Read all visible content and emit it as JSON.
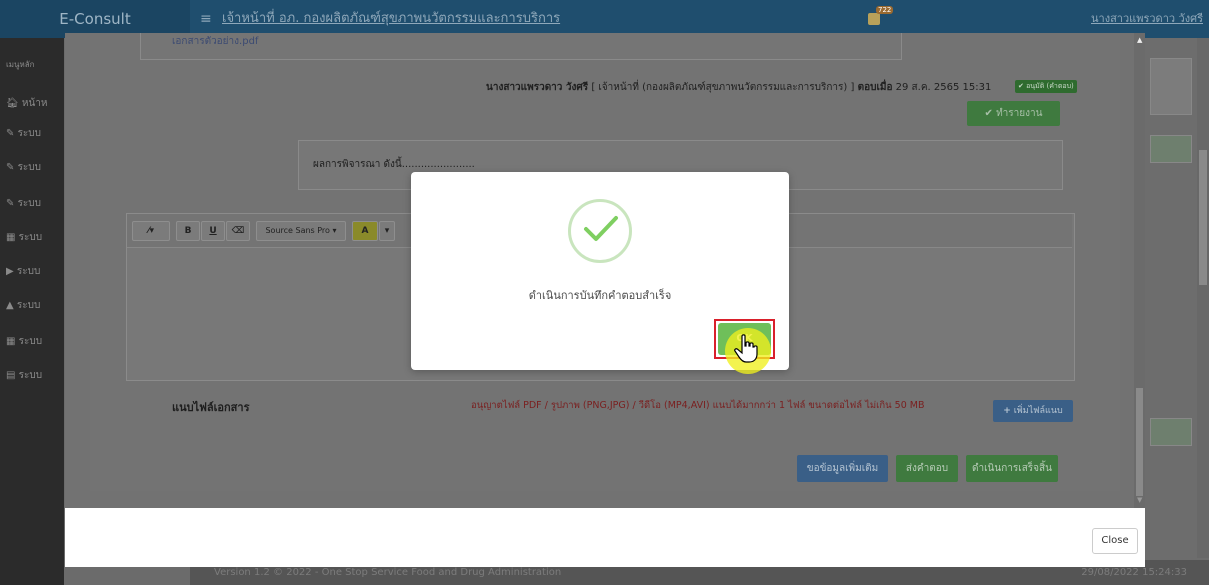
{
  "header": {
    "brand": "E-Consult",
    "title": "เจ้าหน้าที่ อภ. กองผลิตภัณฑ์สุขภาพนวัตกรรมและการบริการ",
    "notif_count": "722",
    "user": "นางสาวแพรวดาว วังศรี"
  },
  "sidebar": {
    "heading": "เมนูหลัก",
    "items": [
      "หน้าห",
      "ระบบ",
      "ระบบ",
      "ระบบ",
      "ระบบ",
      "ระบบ",
      "ระบบ",
      "ระบบ",
      "ระบบ"
    ]
  },
  "modal": {
    "attachment_file": "เอกสารตัวอย่าง.pdf",
    "reply": {
      "author": "นางสาวแพรวดาว วังศรี",
      "role": "[ เจ้าหน้าที่ (กองผลิตภัณฑ์สุขภาพนวัตกรรมและการบริการ) ]",
      "answered_label": "ตอบเมื่อ",
      "date": "29 ส.ค. 2565 15:31",
      "status_badge": "อนุมัติ (คำตอบ)",
      "report_button": "ทำรายงาน"
    },
    "comment_text": "ผลการพิจารณา ดังนี้.......................",
    "editor": {
      "font_select": "Source Sans Pro",
      "bold": "B",
      "underline": "U",
      "color_btn": "A"
    },
    "attach_label": "แนบไฟล์เอกสาร",
    "attach_note": "อนุญาตไฟล์ PDF / รูปภาพ (PNG,JPG) / วีดีโอ (MP4,AVI) แนบได้มากกว่า 1 ไฟล์ ขนาดต่อไฟล์ ไม่เกิน 50 MB",
    "attach_button": "เพิ่มไฟล์แนบ",
    "more_info_button": "ขอข้อมูลเพิ่มเติม",
    "send_button": "ส่งคำตอบ",
    "finish_button": "ดำเนินการเสร็จสิ้น",
    "close_button": "Close"
  },
  "dialog": {
    "message": "ดำเนินการบันทึกคำตอบสำเร็จ",
    "ok_button": "OK"
  },
  "footer": {
    "version": "Version 1.2 © 2022 - One Stop Service Food and Drug Administration",
    "timestamp": "29/08/2022 15:24:33"
  },
  "colors": {
    "success_green": "#6fbf5a",
    "highlight_red": "#d9202b"
  }
}
